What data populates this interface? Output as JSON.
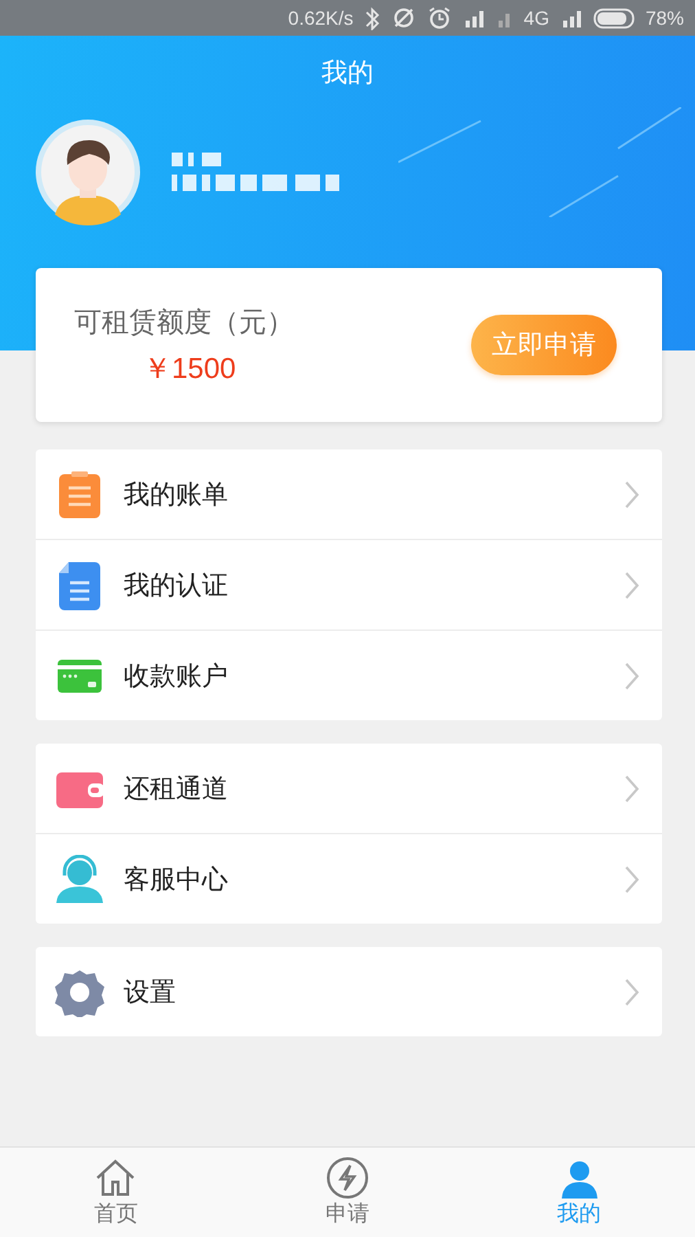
{
  "status_bar": {
    "speed": "0.62K/s",
    "network": "4G",
    "battery": "78%"
  },
  "header": {
    "title": "我的"
  },
  "quota_card": {
    "label": "可租赁额度（元）",
    "amount": "￥1500",
    "button": "立即申请"
  },
  "menu_groups": [
    {
      "items": [
        {
          "label": "我的账单",
          "kind": "bill"
        },
        {
          "label": "我的认证",
          "kind": "document"
        },
        {
          "label": "收款账户",
          "kind": "card"
        }
      ]
    },
    {
      "items": [
        {
          "label": "还租通道",
          "kind": "wallet"
        },
        {
          "label": "客服中心",
          "kind": "support"
        }
      ]
    },
    {
      "items": [
        {
          "label": "设置",
          "kind": "gear"
        }
      ]
    }
  ],
  "bottom_nav": [
    {
      "label": "首页",
      "kind": "home",
      "selected": false
    },
    {
      "label": "申请",
      "kind": "bolt",
      "selected": false
    },
    {
      "label": "我的",
      "kind": "person",
      "selected": true
    }
  ]
}
